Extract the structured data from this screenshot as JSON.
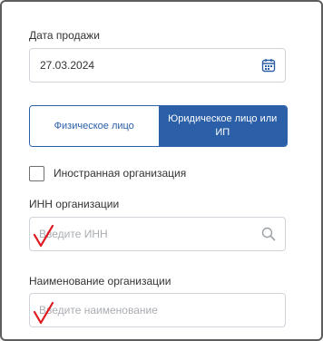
{
  "sale_date": {
    "label": "Дата продажи",
    "value": "27.03.2024",
    "icon": "calendar-icon"
  },
  "entity_type": {
    "options": [
      "Физическое лицо",
      "Юридическое лицо или ИП"
    ],
    "selected": "Юридическое лицо или ИП"
  },
  "foreign_org": {
    "label": "Иностранная организация",
    "checked": false
  },
  "inn": {
    "label": "ИНН организации",
    "placeholder": "Введите ИНН",
    "icon": "search-icon"
  },
  "org_name": {
    "label": "Наименование организации",
    "placeholder": "Введите наименование"
  },
  "colors": {
    "primary": "#2b5fa8",
    "annotation": "#e0191f",
    "border": "#cfd4da"
  }
}
